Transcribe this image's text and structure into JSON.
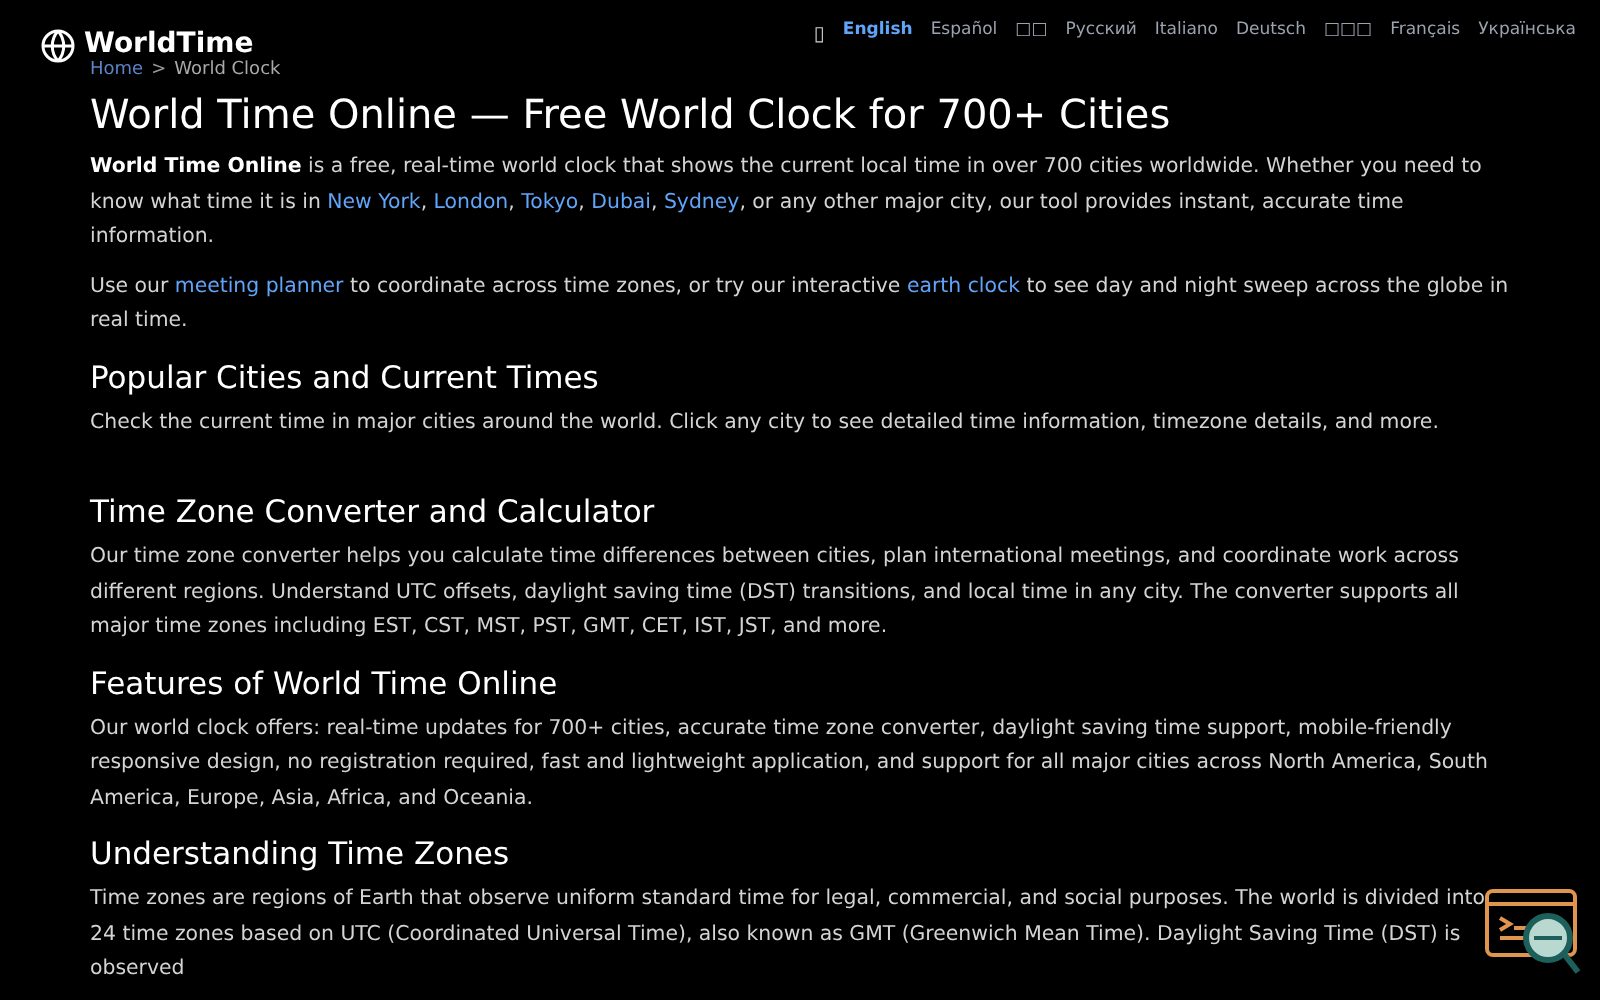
{
  "logo": {
    "text": "WorldTime"
  },
  "breadcrumb": [
    {
      "text": "Home",
      "kind": "link"
    },
    {
      "text": ">",
      "kind": "separator"
    },
    {
      "text": "World Clock",
      "kind": "current"
    }
  ],
  "language_icon": "▯",
  "languages": [
    {
      "label": "English",
      "selected": true
    },
    {
      "label": "Español",
      "selected": false
    },
    {
      "label": "□□",
      "selected": false
    },
    {
      "label": "Русский",
      "selected": false
    },
    {
      "label": "Italiano",
      "selected": false
    },
    {
      "label": "Deutsch",
      "selected": false
    },
    {
      "label": "□□□",
      "selected": false
    },
    {
      "label": "Français",
      "selected": false
    },
    {
      "label": "Українська",
      "selected": false
    }
  ],
  "title": "World Time Online — Free World Clock for 700+ Cities",
  "sections": [
    {
      "kind": "paragraph",
      "parts": [
        {
          "kind": "bold",
          "text": "World Time Online"
        },
        {
          "kind": "text",
          "text": " is a free, real-time world clock that shows the current local time in over 700 cities worldwide. Whether you need to know what time it is in "
        },
        {
          "kind": "link",
          "text": "New York"
        },
        {
          "kind": "text",
          "text": ", "
        },
        {
          "kind": "link",
          "text": "London"
        },
        {
          "kind": "text",
          "text": ", "
        },
        {
          "kind": "link",
          "text": "Tokyo"
        },
        {
          "kind": "text",
          "text": ", "
        },
        {
          "kind": "link",
          "text": "Dubai"
        },
        {
          "kind": "text",
          "text": ", "
        },
        {
          "kind": "link",
          "text": "Sydney"
        },
        {
          "kind": "text",
          "text": ", or any other major city, our tool provides instant, accurate time information."
        }
      ]
    },
    {
      "kind": "paragraph",
      "parts": [
        {
          "kind": "text",
          "text": "Use our "
        },
        {
          "kind": "link",
          "text": "meeting planner"
        },
        {
          "kind": "text",
          "text": " to coordinate across time zones, or try our interactive "
        },
        {
          "kind": "link",
          "text": "earth clock"
        },
        {
          "kind": "text",
          "text": " to see day and night sweep across the globe in real time."
        }
      ]
    },
    {
      "kind": "heading",
      "text": "Popular Cities and Current Times"
    },
    {
      "kind": "paragraph",
      "parts": [
        {
          "kind": "text",
          "text": "Check the current time in major cities around the world. Click any city to see detailed time information, timezone details, and more."
        }
      ]
    },
    {
      "kind": "spacer"
    },
    {
      "kind": "heading",
      "text": "Time Zone Converter and Calculator"
    },
    {
      "kind": "paragraph",
      "parts": [
        {
          "kind": "text",
          "text": "Our time zone converter helps you calculate time differences between cities, plan international meetings, and coordinate work across different regions. Understand UTC offsets, daylight saving time (DST) transitions, and local time in any city. The converter supports all major time zones including EST, CST, MST, PST, GMT, CET, IST, JST, and more."
        }
      ]
    },
    {
      "kind": "heading",
      "text": "Features of World Time Online"
    },
    {
      "kind": "paragraph",
      "parts": [
        {
          "kind": "text",
          "text": "Our world clock offers: real-time updates for 700+ cities, accurate time zone converter, daylight saving time support, mobile-friendly responsive design, no registration required, fast and lightweight application, and support for all major cities across North America, South America, Europe, Asia, Africa, and Oceania."
        }
      ]
    },
    {
      "kind": "heading",
      "text": "Understanding Time Zones"
    },
    {
      "kind": "paragraph",
      "parts": [
        {
          "kind": "text",
          "text": "Time zones are regions of Earth that observe uniform standard time for legal, commercial, and social purposes. The world is divided into 24 time zones based on UTC (Coordinated Universal Time), also known as GMT (Greenwich Mean Time). Daylight Saving Time (DST) is observed"
        }
      ]
    }
  ]
}
